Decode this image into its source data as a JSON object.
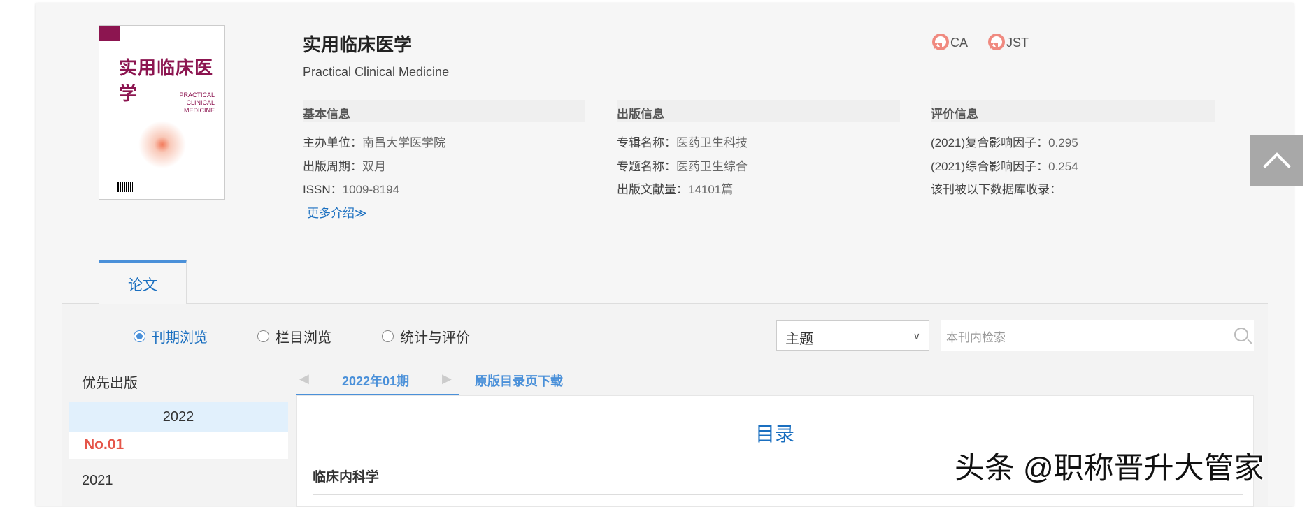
{
  "journal": {
    "title_cn": "实用临床医学",
    "title_en": "Practical Clinical Medicine",
    "cover_text": "实用临床医学",
    "cover_en": "PRACTICAL CLINICAL MEDICINE",
    "more_label": "更多介绍≫"
  },
  "badges": [
    {
      "label": "CA"
    },
    {
      "label": "JST"
    }
  ],
  "basic": {
    "header": "基本信息",
    "rows": [
      {
        "k": "主办单位：",
        "v": "南昌大学医学院"
      },
      {
        "k": "出版周期：",
        "v": "双月"
      },
      {
        "k": "ISSN：",
        "v": "1009-8194"
      }
    ]
  },
  "pub": {
    "header": "出版信息",
    "rows": [
      {
        "k": "专辑名称：",
        "v": "医药卫生科技"
      },
      {
        "k": "专题名称：",
        "v": "医药卫生综合"
      },
      {
        "k": "出版文献量：",
        "v": "14101篇"
      }
    ]
  },
  "eval": {
    "header": "评价信息",
    "rows": [
      {
        "k": "(2021)复合影响因子：",
        "v": "0.295"
      },
      {
        "k": "(2021)综合影响因子：",
        "v": "0.254"
      },
      {
        "k": "该刊被以下数据库收录：",
        "v": ""
      }
    ]
  },
  "tabs": {
    "papers": "论文"
  },
  "radios": [
    {
      "label": "刊期浏览",
      "selected": true
    },
    {
      "label": "栏目浏览",
      "selected": false
    },
    {
      "label": "统计与评价",
      "selected": false
    }
  ],
  "search": {
    "field": "主题",
    "placeholder": "本刊内检索"
  },
  "sidebar": {
    "priority": "优先出版",
    "years": [
      {
        "year": "2022",
        "issues": [
          "No.01"
        ]
      },
      {
        "year": "2021"
      }
    ]
  },
  "issue": {
    "current": "2022年01期",
    "download": "原版目录页下载"
  },
  "toc": {
    "title": "目录",
    "category": "临床内科学"
  },
  "watermark": "头条 @职称晋升大管家"
}
